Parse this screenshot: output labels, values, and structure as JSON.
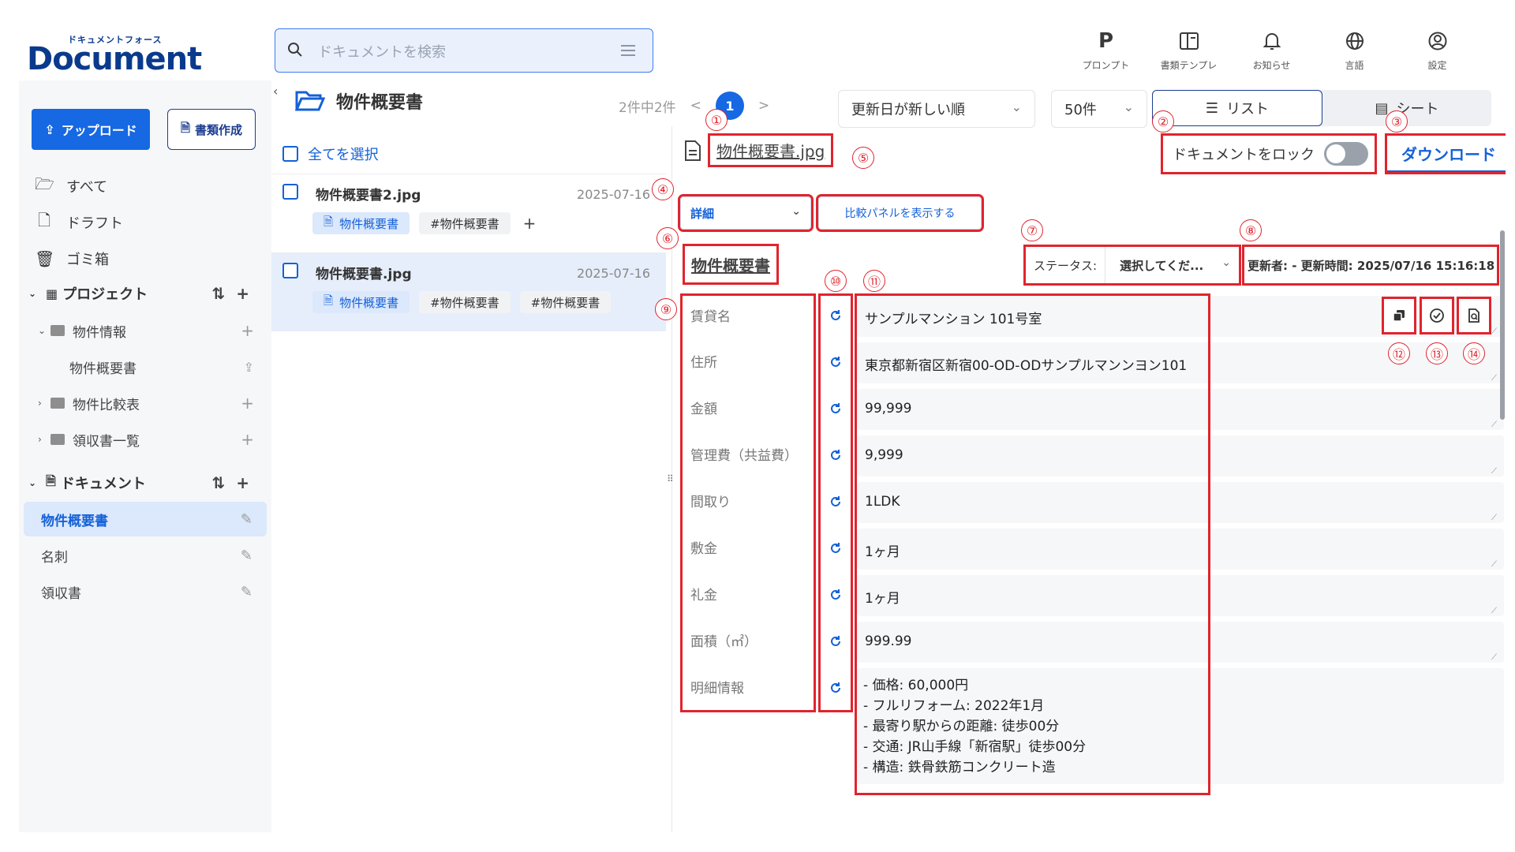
{
  "app": {
    "logo_kana": "ドキュメントフォース",
    "logo_name": "Document Force"
  },
  "search": {
    "placeholder": "ドキュメントを検索"
  },
  "top_icons": [
    {
      "label": "プロンプト",
      "icon": "prompt-icon"
    },
    {
      "label": "書類テンプレ",
      "icon": "template-icon"
    },
    {
      "label": "お知らせ",
      "icon": "bell-icon"
    },
    {
      "label": "言語",
      "icon": "globe-icon"
    },
    {
      "label": "設定",
      "icon": "user-settings-icon"
    }
  ],
  "sidebar": {
    "upload_label": "アップロード",
    "create_label": "書類作成",
    "nav": [
      {
        "label": "すべて",
        "icon": "folder-open-icon"
      },
      {
        "label": "ドラフト",
        "icon": "file-icon"
      },
      {
        "label": "ゴミ箱",
        "icon": "trash-icon"
      }
    ],
    "project_section": "プロジェクト",
    "projects": [
      {
        "label": "物件情報",
        "expanded": true
      },
      {
        "label": "物件概要書",
        "child": true
      },
      {
        "label": "物件比較表",
        "expanded": false
      },
      {
        "label": "領収書一覧",
        "expanded": false
      }
    ],
    "document_section": "ドキュメント",
    "documents": [
      {
        "label": "物件概要書",
        "active": true
      },
      {
        "label": "名刺",
        "active": false
      },
      {
        "label": "領収書",
        "active": false
      }
    ]
  },
  "list": {
    "folder_title": "物件概要書",
    "count_text": "2件中2件",
    "page_prev": "<",
    "page_current": "1",
    "page_next": ">",
    "sort_value": "更新日が新しい順",
    "per_page_value": "50件",
    "view_list": "リスト",
    "view_sheet": "シート",
    "select_all": "全てを選択",
    "items": [
      {
        "name": "物件概要書2.jpg",
        "date": "2025-07-16",
        "tags": [
          "物件概要書",
          "#物件概要書"
        ],
        "add": "+",
        "active": false
      },
      {
        "name": "物件概要書.jpg",
        "date": "2025-07-16",
        "tags": [
          "物件概要書",
          "#物件概要書",
          "#物件概要書"
        ],
        "active": true
      }
    ]
  },
  "detail": {
    "file_name": "物件概要書.jpg",
    "lock_label": "ドキュメントをロック",
    "lock_on": false,
    "download_label": "ダウンロード",
    "view_select": "詳細",
    "compare_label": "比較パネルを表示する",
    "section_title": "物件概要書",
    "status_label": "ステータス:",
    "status_value": "選択してくだ...",
    "updater_text": "更新者:  -   更新時間:  2025/07/16 15:16:18",
    "fields": [
      {
        "label": "賃貸名",
        "value": "サンプルマンション 101号室"
      },
      {
        "label": "住所",
        "value": "東京都新宿区新宿00-OD-ODサンプルマンンヨン101"
      },
      {
        "label": "金額",
        "value": "99,999"
      },
      {
        "label": "管理費（共益費）",
        "value": "9,999"
      },
      {
        "label": "間取り",
        "value": "1LDK"
      },
      {
        "label": "敷金",
        "value": "1ヶ月"
      },
      {
        "label": "礼金",
        "value": "1ヶ月"
      },
      {
        "label": "面積（㎡）",
        "value": "999.99"
      },
      {
        "label": "明細情報",
        "value": ""
      }
    ],
    "detail_lines": [
      "- 価格: 60,000円",
      "- フルリフォーム: 2022年1月",
      "- 最寄り駅からの距離: 徒歩00分",
      "- 交通: JR山手線「新宿駅」徒歩00分",
      "- 構造: 鉄骨鉄筋コンクリート造"
    ],
    "annotations": [
      "①",
      "②",
      "③",
      "④",
      "⑤",
      "⑥",
      "⑦",
      "⑧",
      "⑨",
      "⑩",
      "⑪",
      "⑫",
      "⑬",
      "⑭"
    ]
  },
  "colors": {
    "accent": "#1668e3",
    "annotation": "#e0242d",
    "brand": "#0a3a8c"
  }
}
